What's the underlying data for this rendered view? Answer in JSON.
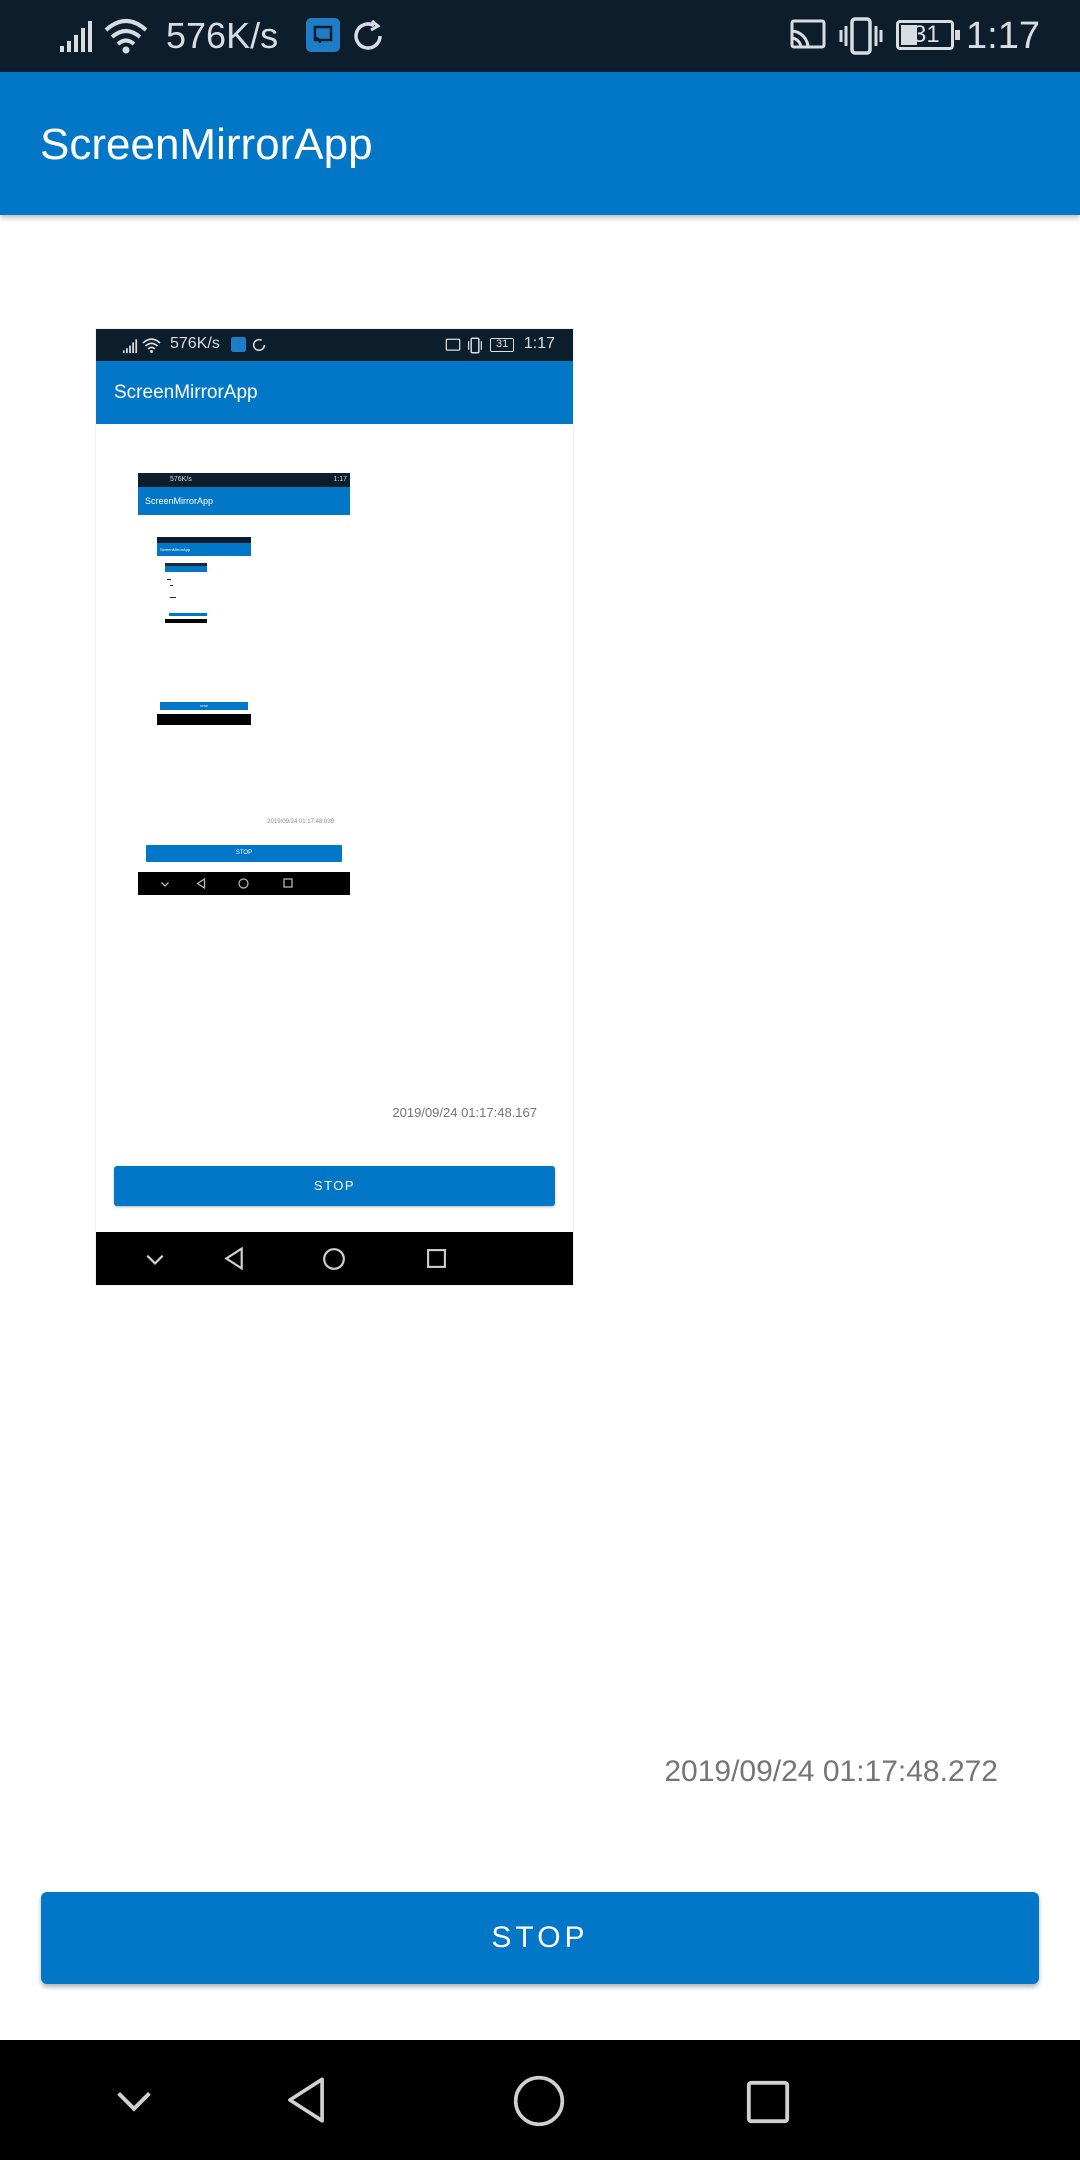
{
  "status_bar": {
    "network_speed": "576K/s",
    "time": "1:17",
    "battery": "31"
  },
  "app_bar": {
    "title": "ScreenMirrorApp"
  },
  "mirror": {
    "status_bar": {
      "network_speed": "576K/s",
      "time": "1:17",
      "battery": "31"
    },
    "title": "ScreenMirrorApp",
    "timestamp": "2019/09/24 01:17:48.167",
    "stop_label": "STOP",
    "nested": {
      "status_bar": {
        "network_speed": "576K/s",
        "time": "1:17"
      },
      "title": "ScreenMirrorApp",
      "timestamp": "2019/09/24 01:17:48.039",
      "stop_label": "STOP",
      "nested": {
        "title": "ScreenMirrorApp",
        "stop_label": "STOP"
      }
    }
  },
  "timestamp": "2019/09/24 01:17:48.272",
  "stop_button": {
    "label": "STOP"
  },
  "colors": {
    "primary": "#0277c8",
    "status_bar": "#0c1d2b",
    "nav_bar": "#000000",
    "timestamp_text": "#757575"
  },
  "nav_bar": {
    "buttons": [
      "chevron-down-icon",
      "back-icon",
      "home-icon",
      "recents-icon"
    ]
  }
}
